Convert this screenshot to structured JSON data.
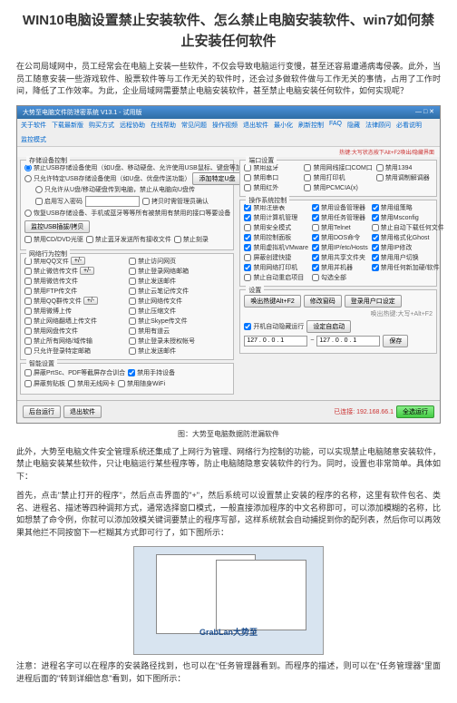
{
  "title": "WIN10电脑设置禁止安装软件、怎么禁止电脑安装软件、win7如何禁止安装任何软件",
  "intro": "在公司局域网中，员工经常会在电脑上安装一些软件，不仅会导致电脑运行变慢，甚至还容易遭通病毒侵袭。此外，当员工随意安装一些游戏软件、股票软件等与工作无关的软件时，还会过多做软件做与工作无关的事情，占用了工作时间，降低了工作效率。为此，企业局域网需要禁止电脑安装软件，甚至禁止电脑安装任何软件，如何实现呢？",
  "app": {
    "title": "大势至电脑文件防泄密系统 V13.1 - 试用版",
    "menus": [
      "关于软件",
      "下载最新版",
      "购买方式",
      "远程协助",
      "在线帮助",
      "常见问题",
      "操作视频",
      "退出软件",
      "最小化",
      "刷新控制",
      "FAQ",
      "隐藏",
      "法律顾问",
      "必看说明",
      "监控模式"
    ],
    "hint": "热键:大写状态按下Alt+F2唤出/隐藏界面",
    "g_storage": {
      "title": "存储设备控制",
      "r1": "禁止USB存储设备使用（如U盘、移动硬盘、允许使用USB鼠标、键盘等加密狗等）",
      "r2": "只允许特定USB存储设备使用（如U盘、优盘传送功能）",
      "subopt": "只允许从U盘/移动硬盘传到电脑，禁止从电脑向U盘传",
      "b1": "添加特定U盘",
      "c_pwd": "启用写入密码",
      "c_log": "拷贝时需管理员确认",
      "b2": "监控USB插拔/拷贝",
      "c_burn": "恢复USB存储设备、手机或蓝牙等等所有被禁用有禁用的接口等要设备",
      "c_cd": "禁用CD/DVD光驱",
      "c_bt": "禁止蓝牙发送所有接收文件",
      "sub": "禁止刻录"
    },
    "g_upload": {
      "title": "网络行为控制",
      "items": [
        "禁用QQ文件",
        "禁止微信传文件",
        "禁用微信传文件",
        "禁用FTP传文件",
        "禁用QQ群传文件",
        "禁用微博上传",
        "禁止网络翻墙上传文件",
        "禁用网盘传文件",
        "禁止所有网络/域传输",
        "禁止登录未授权帐号",
        "只允许登录特定邮箱",
        "禁止发送邮件",
        "禁止访问网页",
        "禁止登录网络邮箱",
        "禁止发送邮件",
        "禁止云笔记传文件",
        "禁止网络传文件",
        "禁止压缩文件",
        "禁止Skype传文件",
        "禁用有道云"
      ],
      "btns": [
        "+/-",
        "+/-",
        "+/-"
      ]
    },
    "g_opt": {
      "title": "智能设置",
      "c1": "屏蔽PrtSc、PDF等截屏存合训合",
      "c2": "禁用手持设备",
      "c3": "屏蔽剪贴板",
      "c4": "禁用无线网卡",
      "c5": "禁用随身WiFi"
    },
    "g_port": {
      "title": "端口设置",
      "items": [
        "禁用蓝牙",
        "禁用串口",
        "禁用红外",
        "禁用网线接口COM口",
        "禁用打印机",
        "禁用调制解调器",
        "禁用PCMCIA(x)",
        "禁用1394"
      ]
    },
    "g_reg": {
      "title": "操作系统控制",
      "items": [
        "禁用注册表",
        "禁用设备管理器",
        "禁用组策略",
        "禁用计算机管理",
        "禁用任务管理器",
        "禁用Msconfig",
        "禁用安全模式",
        "禁用Telnet",
        "禁用控制面板",
        "禁用DOS命令",
        "禁用格式化Ghost",
        "禁用虚拟机VMware",
        "禁用IP/etc/Hosts",
        "禁用IP修改",
        "屏蔽创建快捷",
        "禁用共享文件夹",
        "禁用用户切换",
        "禁用网络打印机",
        "禁用并机器",
        "禁用任何新加硬/软件",
        "禁止自动重启项目",
        "勾选全部",
        "禁止自动下载任何文件"
      ],
      "chk": "设置",
      "b_hotkey": "唤出热键Alt+F2",
      "b_pwd": "修改窗码",
      "b_login": "登录用户口设定",
      "note": "唤出热键:大写+Alt+F2",
      "c_auto": "开机自动隐藏运行",
      "b_boot": "设定自启动",
      "ip_label": "",
      "ip1": "127 . 0 . 0 . 1",
      "ip2": "127 . 0 . 0 . 1",
      "b_save": "保存"
    },
    "footer": {
      "b1": "后台运行",
      "b2": "退出软件",
      "ip": "已连接: 192.168.66.1",
      "b3": "全选运行"
    }
  },
  "caption1": "图：大势至电脑数据防泄漏软件",
  "para2": "此外，大势至电脑文件安全管理系统还集成了上网行为管理、网络行为控制的功能，可以实现禁止电脑随意安装软件，禁止电脑安装某些软件，只让电脑运行某些程序等，防止电脑随隐意安装软件的行为。同时，设置也非常简单。具体如下：",
  "para3": "首先，点击\"禁止打开的程序\"，然后点击界面的\"+\"，然后系统可以设置禁止安装的程序的名称，这里有软件包名、类名、进程名、描述等四种调邦方式，通常选择窗口模式，一般直接添加程序的中文名称即可，可以添加模糊的名称，比如想禁了命令例，你就可以添加效模关键词要禁止的程序写部，这样系统就会自动捕捉到你的配列表，然后你可以再效果其他拦不同按窗下一栏糊其方式即可行了，如下图所示：",
  "thumb_logo": "GrabLan大势至",
  "para4": "注意：进程名字可以在程序的安装路径找到，也可以在\"任务管理器看到。而程序的描述，则可以在\"任务管理器\"里面进程后面的\"转到详细信息\"看到，如下图所示："
}
